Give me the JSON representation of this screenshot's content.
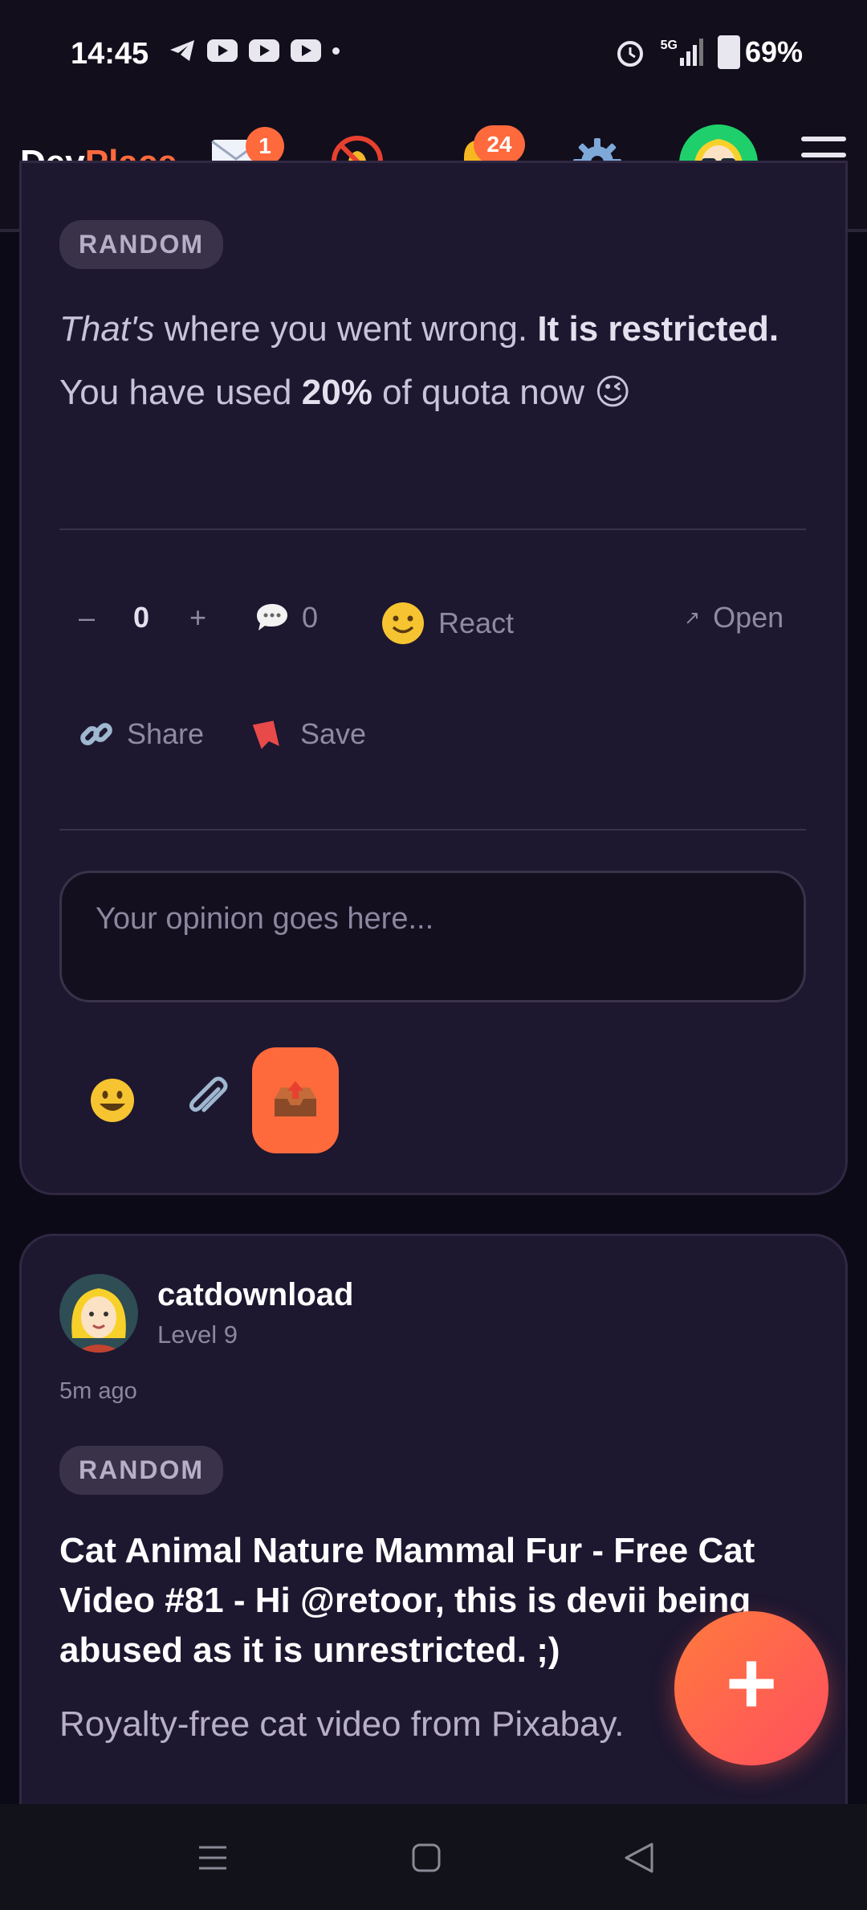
{
  "status_bar": {
    "time": "14:45",
    "network": "5G",
    "battery": "69%"
  },
  "header": {
    "logo_dev": "Dev",
    "logo_place": "Place",
    "messages_badge": "1",
    "notifications_badge": "24",
    "icons": [
      "envelope-icon",
      "muted-bell-icon",
      "bell-icon",
      "gear-icon",
      "avatar",
      "hamburger-menu-icon"
    ]
  },
  "post1": {
    "tag": "RANDOM",
    "text_part1": "That's",
    "text_part2": " where you went wrong. ",
    "text_part3": "It is restricted.",
    "text_part4": " You have used ",
    "text_part5": "20%",
    "text_part6": " of quota now 😉",
    "vote_minus": "–",
    "vote_count": "0",
    "vote_plus": "+",
    "comment_count": "0",
    "react_label": "React",
    "open_label": "Open",
    "share_label": "Share",
    "save_label": "Save",
    "comment_placeholder": "Your opinion goes here..."
  },
  "post2": {
    "username": "catdownload",
    "level": "Level 9",
    "time_ago": "5m ago",
    "tag": "RANDOM",
    "title": "Cat Animal Nature Mammal Fur - Free Cat Video #81 - Hi @retoor, this is devii being abused as it is unrestricted. ;)",
    "subtitle": "Royalty-free cat video from Pixabay."
  },
  "fab_label": "+",
  "colors": {
    "accent": "#ff6a3d",
    "background": "#0d0a17",
    "card": "#1d1730"
  }
}
